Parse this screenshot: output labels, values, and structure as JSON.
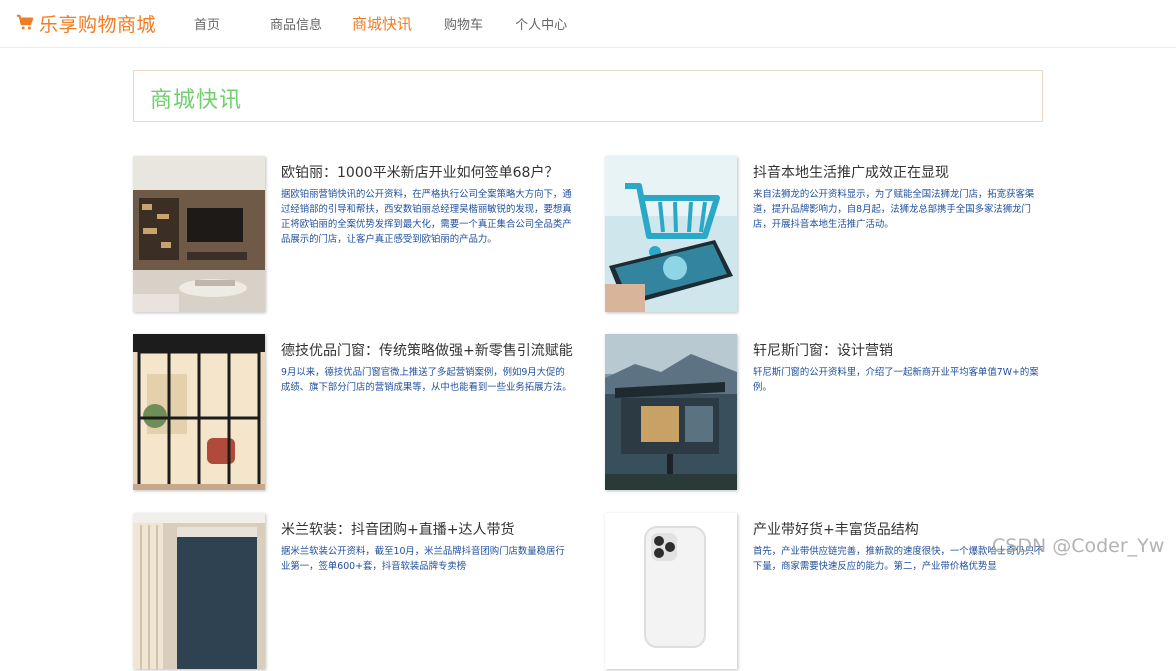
{
  "header": {
    "brand": "乐享购物商城",
    "nav": [
      "首页",
      "商品信息",
      "商城快讯",
      "购物车",
      "个人中心"
    ]
  },
  "section": {
    "title": "商城快讯"
  },
  "news": [
    {
      "title": "欧铂丽：1000平米新店开业如何签单68户？",
      "desc": "据欧铂丽营销快讯的公开资料，在严格执行公司全案策略大方向下，通过经销部的引导和帮扶，西安数铂丽总经理吴楷丽敏锐的发现，要想真正将欧铂丽的全案优势发挥到最大化，需要一个真正集合公司全品类产品展示的门店，让客户真正感受到欧铂丽的产品力。"
    },
    {
      "title": "抖音本地生活推广成效正在显现",
      "desc": "来自法狮龙的公开资料显示，为了赋能全国法狮龙门店，拓宽获客渠道，提升品牌影响力，自8月起，法狮龙总部携手全国多家法狮龙门店，开展抖音本地生活推广活动。"
    },
    {
      "title": "德技优品门窗：传统策略做强+新零售引流赋能",
      "desc": "9月以来，德技优品门窗官微上推送了多起营销案例，例如9月大促的成绩、旗下部分门店的营销成果等，从中也能看到一些业务拓展方法。"
    },
    {
      "title": "轩尼斯门窗：设计营销",
      "desc": "轩尼斯门窗的公开资料里，介绍了一起新商开业平均客单值7W+的案例。"
    },
    {
      "title": "米兰软装：抖音团购+直播+达人带货",
      "desc": "据米兰软装公开资料，截至10月，米兰品牌抖音团购门店数量稳居行业第一，签单600+套，抖音软装品牌专卖榜"
    },
    {
      "title": "产业带好货+丰富货品结构",
      "desc": "首先，产业带供应链完善，推新款的速度很快，一个爆款哈士奇仍只不下量，商家需要快速反应的能力。第二，产业带价格优势显"
    }
  ],
  "watermark": "CSDN @Coder_Yw",
  "colors": {
    "brand": "#f07c23",
    "section_title": "#6fd06b",
    "desc_text": "#1f4f9c"
  }
}
